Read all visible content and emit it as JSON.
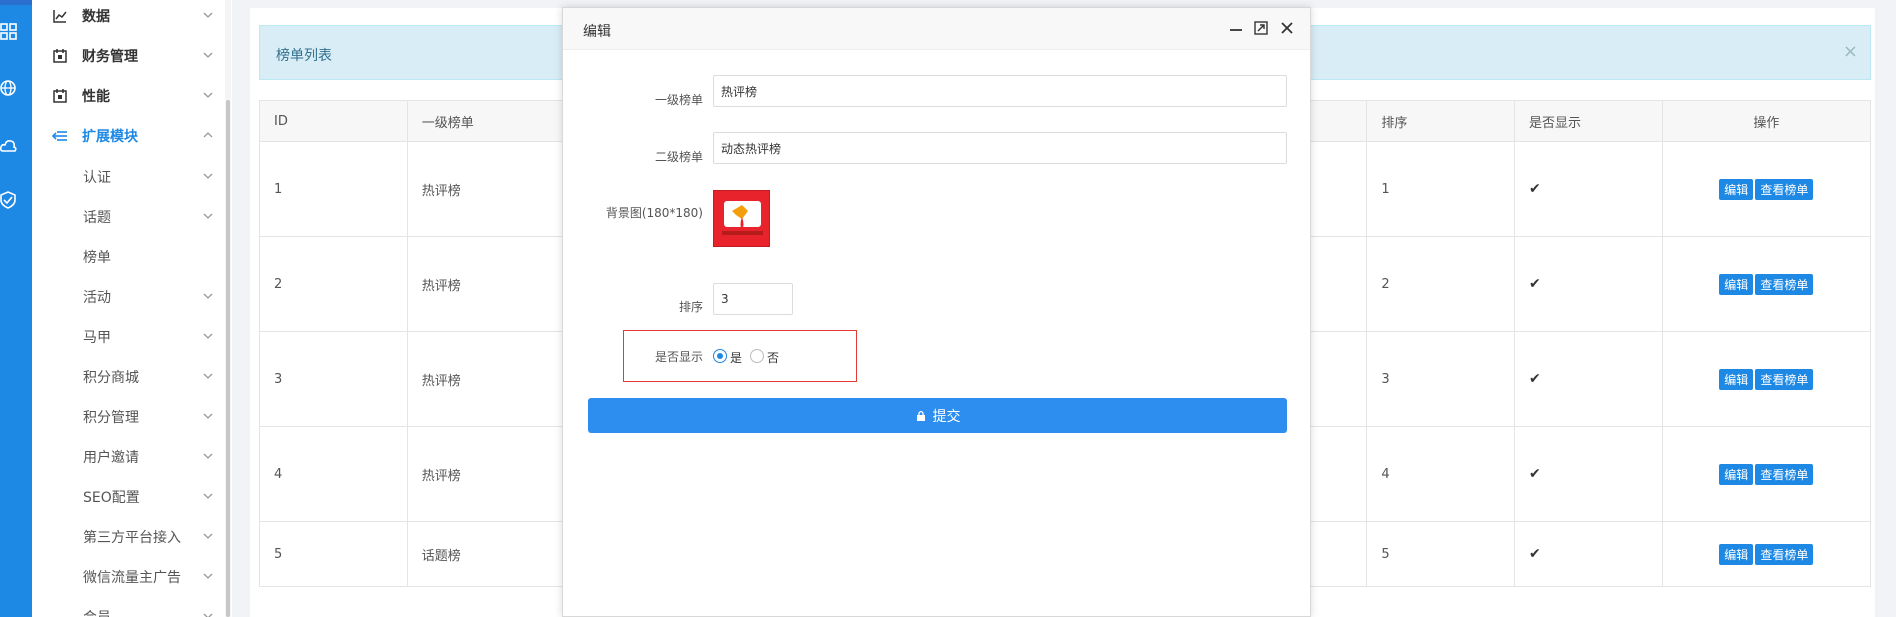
{
  "sidebar": {
    "menus": [
      {
        "label": "数据",
        "icon": "chart-line-icon"
      },
      {
        "label": "财务管理",
        "icon": "calendar-icon"
      },
      {
        "label": "性能",
        "icon": "calendar-icon"
      },
      {
        "label": "扩展模块",
        "icon": "sliders-icon"
      }
    ],
    "subs": [
      "认证",
      "话题",
      "榜单",
      "活动",
      "马甲",
      "积分商城",
      "积分管理",
      "用户邀请",
      "SEO配置",
      "第三方平台接入",
      "微信流量主广告",
      "会员"
    ]
  },
  "alert": {
    "text": "榜单列表",
    "close": "×"
  },
  "table": {
    "headers": [
      "ID",
      "一级榜单",
      "排序",
      "是否显示",
      "操作"
    ],
    "rows": [
      {
        "id": "1",
        "name": "热评榜",
        "sort": "1"
      },
      {
        "id": "2",
        "name": "热评榜",
        "sort": "2"
      },
      {
        "id": "3",
        "name": "热评榜",
        "sort": "3"
      },
      {
        "id": "4",
        "name": "热评榜",
        "sort": "4"
      },
      {
        "id": "5",
        "name": "话题榜",
        "sort": "5"
      }
    ],
    "check": "✔",
    "edit_label": "编辑",
    "view_label": "查看榜单"
  },
  "modal": {
    "title": "编辑",
    "level1_label": "一级榜单",
    "level1_value": "热评榜",
    "level2_label": "二级榜单",
    "level2_value": "动态热评榜",
    "bg_label": "背景图(180*180)",
    "sort_label": "排序",
    "sort_value": "3",
    "show_label": "是否显示",
    "yes": "是",
    "no": "否",
    "submit": "提交"
  },
  "colors": {
    "primary": "#1e88e5",
    "alert_bg": "#d9edf7",
    "highlight": "#e53935"
  }
}
